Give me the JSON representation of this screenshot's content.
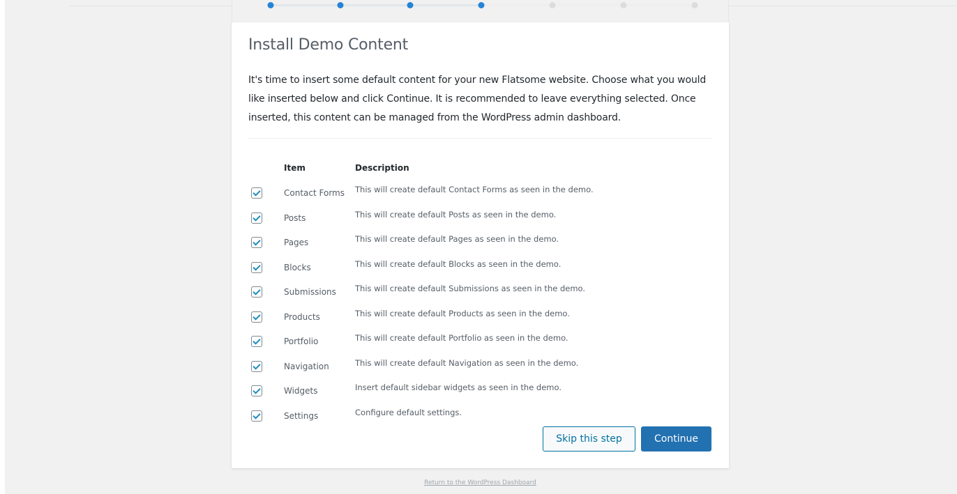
{
  "colors": {
    "accent": "#2271b1",
    "step_done": "#2683d6",
    "step_pending": "#dcdcde",
    "checkmark": "#1e8cbe"
  },
  "progress": {
    "total_steps": 7,
    "completed_steps": 4
  },
  "title": "Install Demo Content",
  "intro": "It's time to insert some default content for your new Flatsome website. Choose what you would like inserted below and click Continue. It is recommended to leave everything selected. Once inserted, this content can be managed from the WordPress admin dashboard.",
  "table": {
    "headers": {
      "item": "Item",
      "description": "Description"
    },
    "rows": [
      {
        "checked": true,
        "item": "Contact Forms",
        "description": "This will create default Contact Forms as seen in the demo."
      },
      {
        "checked": true,
        "item": "Posts",
        "description": "This will create default Posts as seen in the demo."
      },
      {
        "checked": true,
        "item": "Pages",
        "description": "This will create default Pages as seen in the demo."
      },
      {
        "checked": true,
        "item": "Blocks",
        "description": "This will create default Blocks as seen in the demo."
      },
      {
        "checked": true,
        "item": "Submissions",
        "description": "This will create default Submissions as seen in the demo."
      },
      {
        "checked": true,
        "item": "Products",
        "description": "This will create default Products as seen in the demo."
      },
      {
        "checked": true,
        "item": "Portfolio",
        "description": "This will create default Portfolio as seen in the demo."
      },
      {
        "checked": true,
        "item": "Navigation",
        "description": "This will create default Navigation as seen in the demo."
      },
      {
        "checked": true,
        "item": "Widgets",
        "description": "Insert default sidebar widgets as seen in the demo."
      },
      {
        "checked": true,
        "item": "Settings",
        "description": "Configure default settings."
      }
    ]
  },
  "buttons": {
    "skip": "Skip this step",
    "continue": "Continue"
  },
  "footer_link": "Return to the WordPress Dashboard"
}
